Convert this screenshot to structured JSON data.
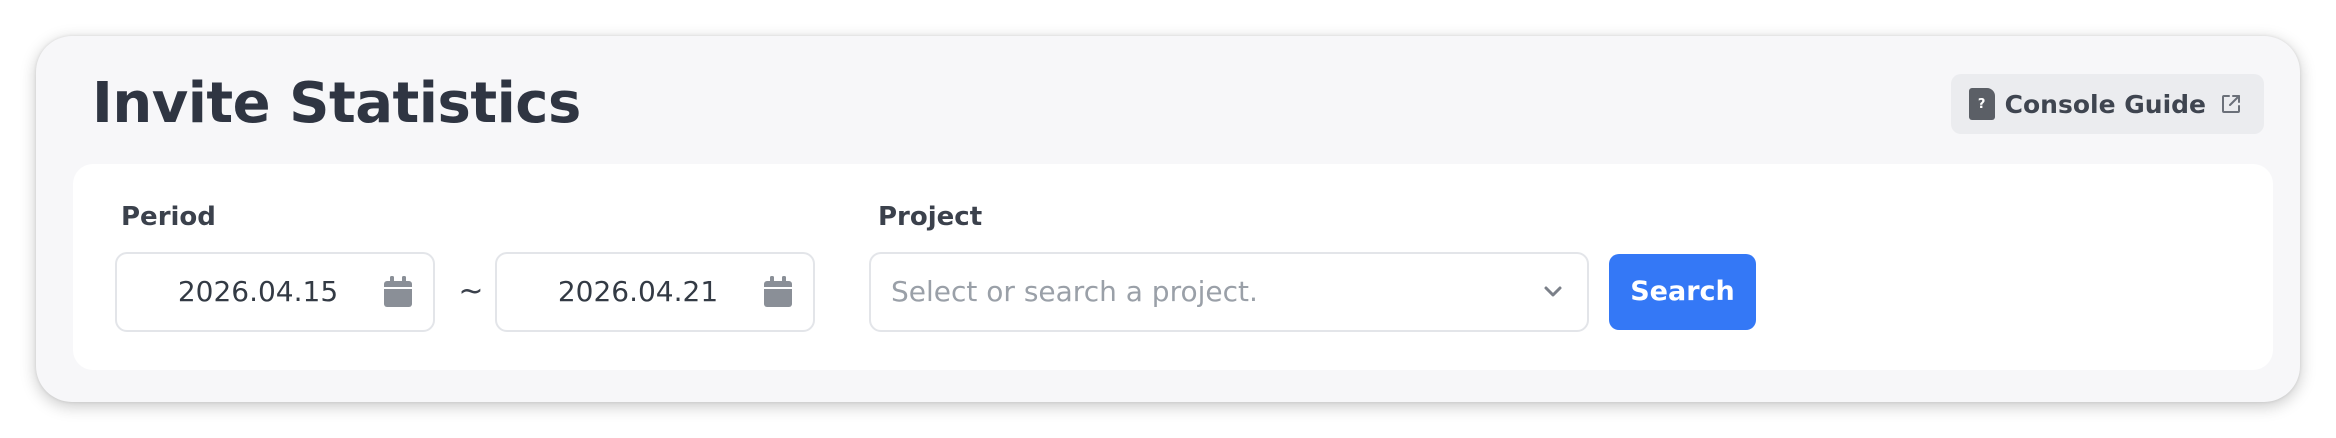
{
  "header": {
    "title": "Invite Statistics",
    "guide_button": {
      "label": "Console Guide",
      "doc_icon": "help-document-icon",
      "doc_icon_glyph": "?",
      "external_icon": "external-link-icon"
    }
  },
  "filters": {
    "period": {
      "label": "Period",
      "start_date": "2026.04.15",
      "end_date": "2026.04.21",
      "separator": "~",
      "calendar_icon": "calendar-icon"
    },
    "project": {
      "label": "Project",
      "placeholder": "Select or search a project.",
      "chevron_icon": "chevron-down-icon"
    },
    "search_button": {
      "label": "Search"
    }
  },
  "colors": {
    "accent": "#3478f6",
    "title": "#2f3542",
    "card_background": "#f7f7f9",
    "panel_background": "#ffffff",
    "placeholder": "#9aa0a8"
  }
}
